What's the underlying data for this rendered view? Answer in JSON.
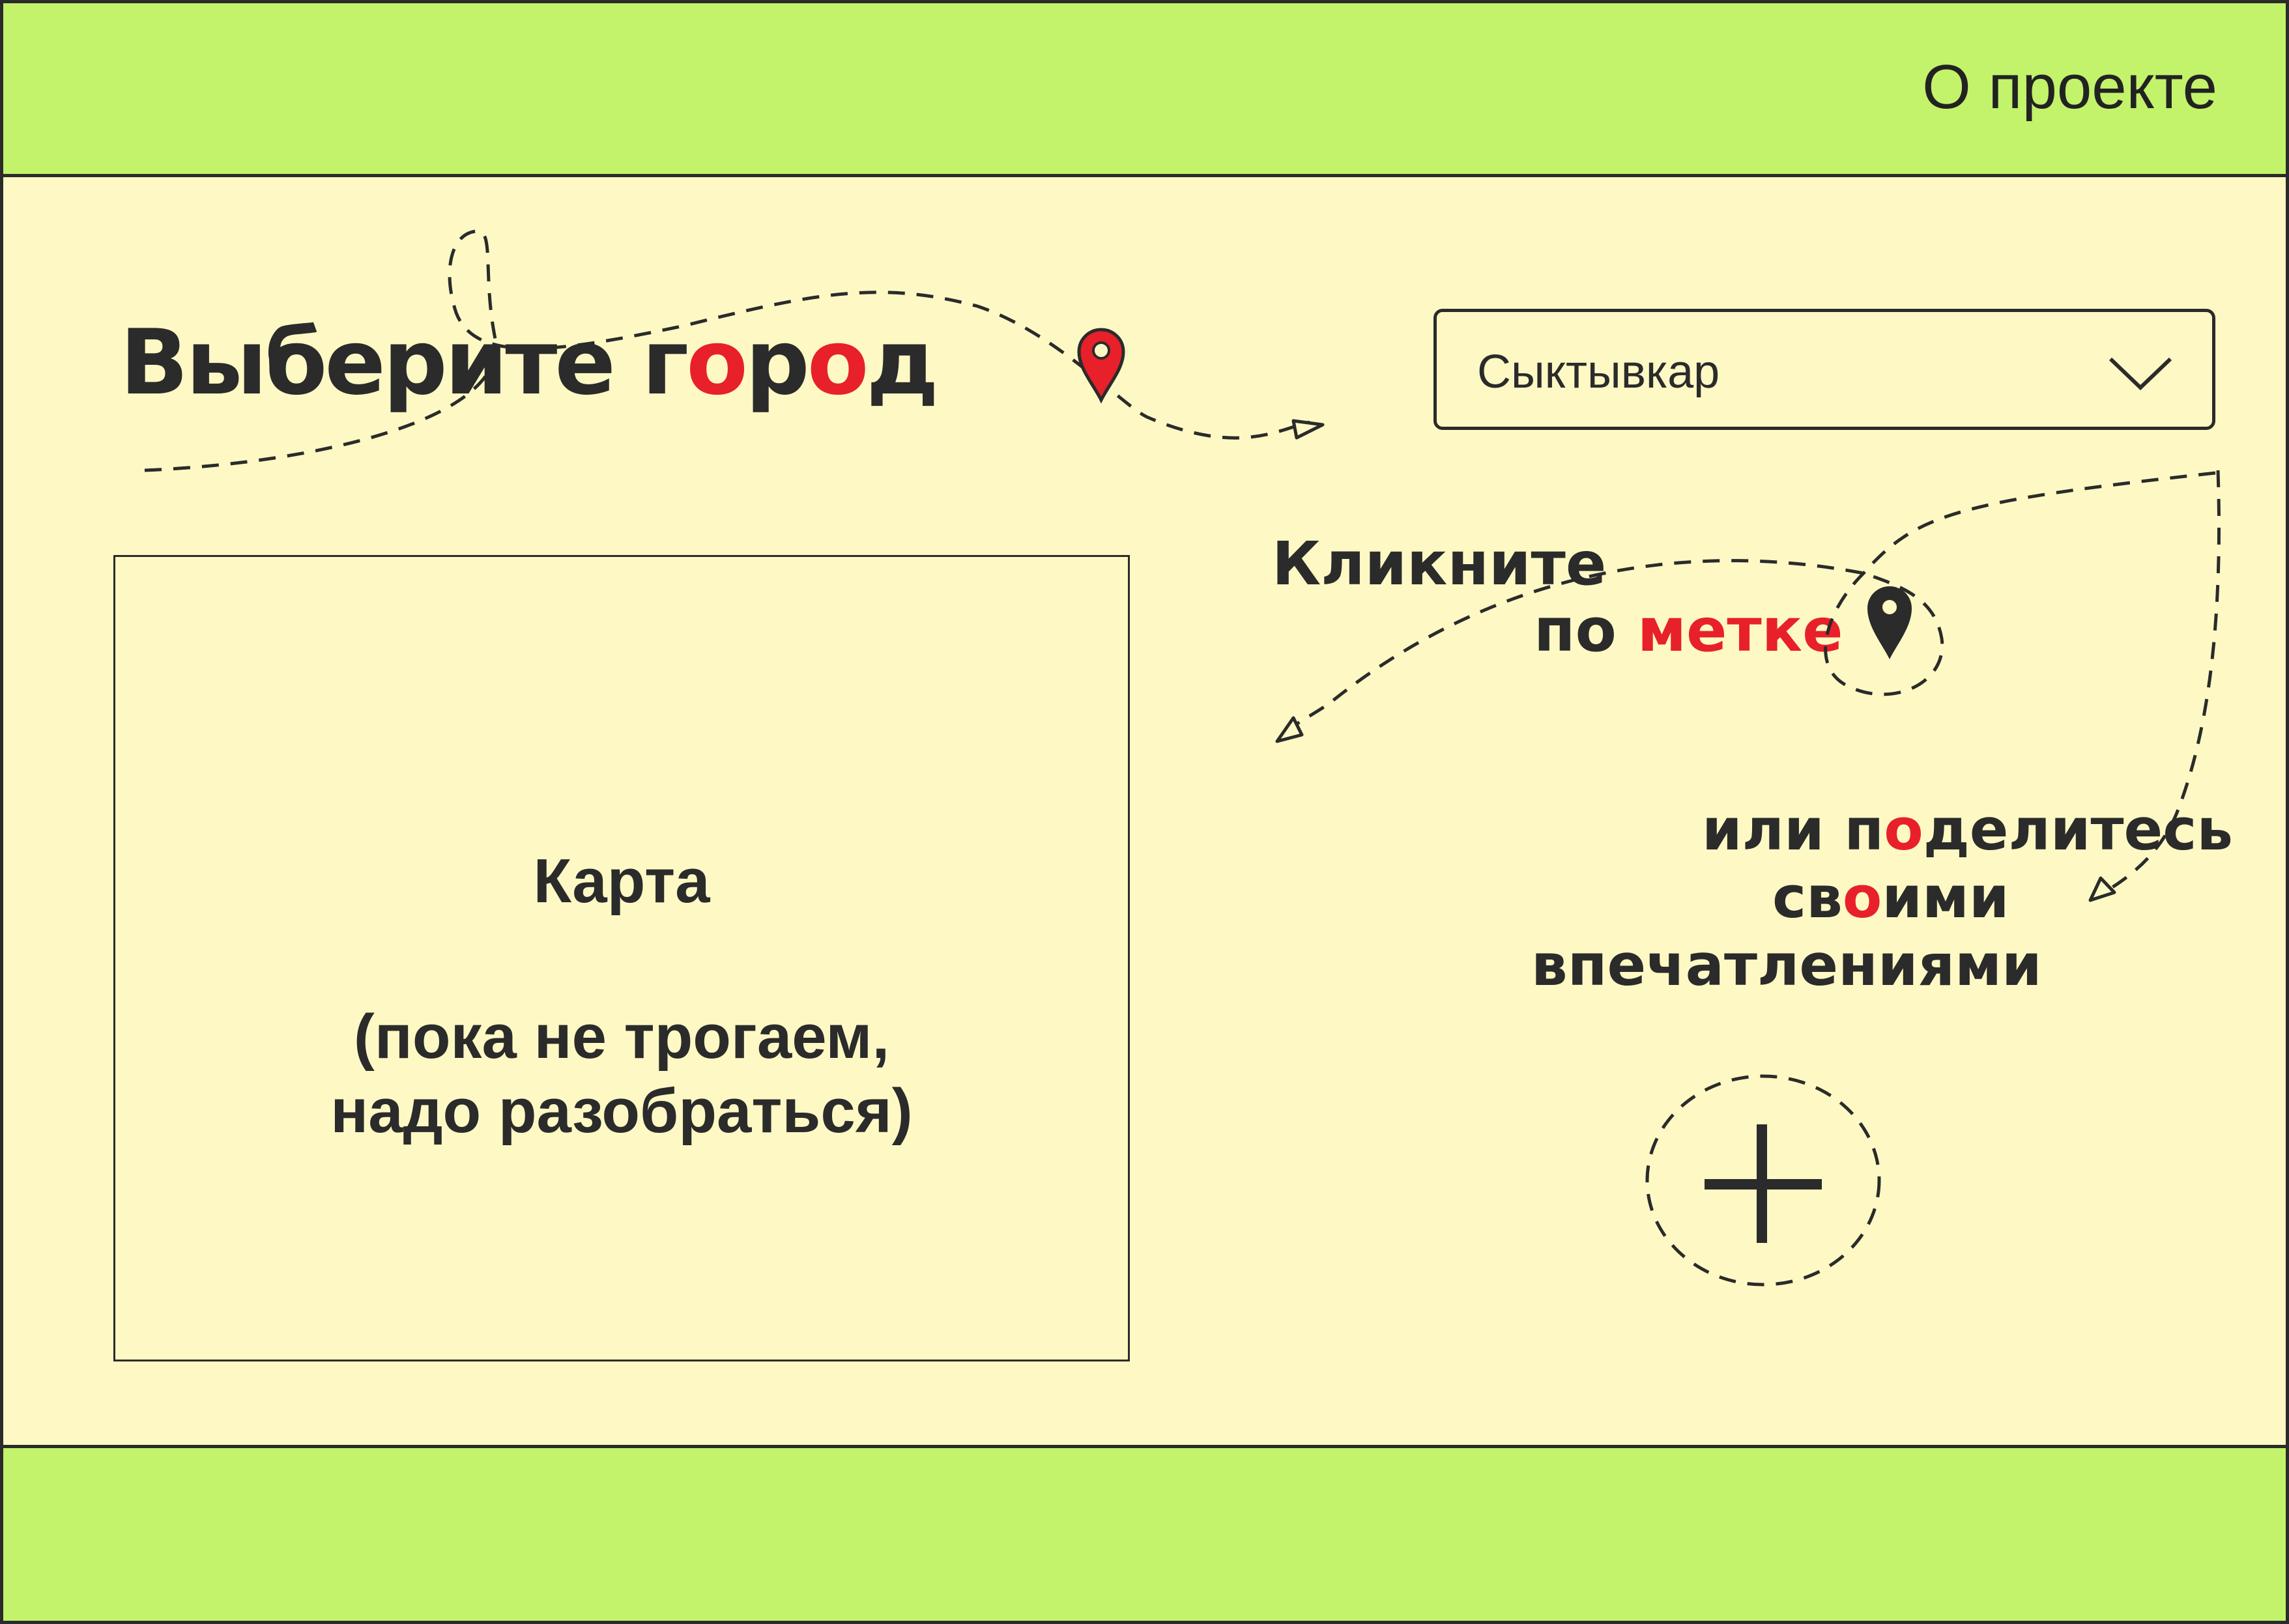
{
  "header": {
    "about_link": "О проекте"
  },
  "city_section": {
    "title_parts": [
      "Выберите г",
      "о",
      "р",
      "о",
      "д"
    ],
    "selected_city": "Сыктывкар"
  },
  "map": {
    "title": "Карта",
    "note_line1": "(пока не трогаем,",
    "note_line2": "надо разобраться)"
  },
  "click_hint": {
    "line1": "Кликните",
    "line2_prefix": "по ",
    "line2_accent": "метке"
  },
  "share_hint": {
    "line1_prefix": "или п",
    "line1_accent": "о",
    "line1_suffix": "делитесь",
    "line2_prefix": "св",
    "line2_accent": "о",
    "line2_suffix": "ими",
    "line3": "впечатлениями"
  },
  "icons": {
    "pin_red": "map-pin-icon",
    "pin_dark": "map-pin-icon",
    "add": "plus-icon",
    "dropdown": "chevron-down-icon"
  },
  "colors": {
    "header_footer_bg": "#c2f36a",
    "page_bg": "#fef9c4",
    "accent": "#e8202a",
    "text": "#2b2b2b"
  }
}
